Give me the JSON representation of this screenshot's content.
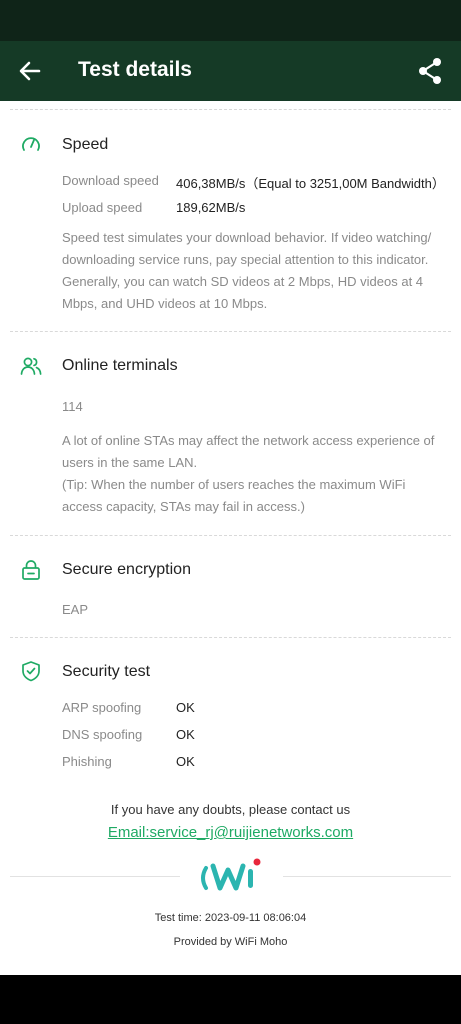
{
  "header": {
    "title": "Test details",
    "back_icon": "arrow-left-icon",
    "share_icon": "share-icon"
  },
  "speed": {
    "title": "Speed",
    "icon": "speedometer-icon",
    "download_label": "Download speed",
    "download_value": "406,38MB/s（Equal to 3251,00M Bandwidth）",
    "upload_label": "Upload speed",
    "upload_value": "189,62MB/s",
    "description": "Speed test simulates your download behavior. If video watching/ downloading service runs, pay special attention to this indicator. Generally, you can watch SD videos at 2 Mbps, HD videos at 4 Mbps, and UHD videos at 10 Mbps."
  },
  "terminals": {
    "title": "Online terminals",
    "icon": "users-icon",
    "count": "114",
    "description": "A lot of online STAs may affect the network access experience of users in the same LAN.",
    "tip": "(Tip: When the number of users reaches the maximum WiFi access capacity, STAs may fail in access.)"
  },
  "encryption": {
    "title": "Secure encryption",
    "icon": "lock-icon",
    "value": "EAP"
  },
  "security": {
    "title": "Security test",
    "icon": "shield-check-icon",
    "items": [
      {
        "label": "ARP spoofing",
        "value": "OK"
      },
      {
        "label": "DNS spoofing",
        "value": "OK"
      },
      {
        "label": "Phishing",
        "value": "OK"
      }
    ]
  },
  "footer": {
    "contact": "If you have any doubts, please contact us",
    "email": "Email:service_rj@ruijienetworks.com",
    "test_time": "Test time: 2023-09-11 08:06:04",
    "provided_by": "Provided by WiFi Moho"
  },
  "colors": {
    "accent": "#1faa64",
    "header_bg": "#153a26",
    "statusbar_bg": "#0f2418",
    "logo_teal": "#2bb5b0",
    "logo_red": "#e8283c"
  }
}
